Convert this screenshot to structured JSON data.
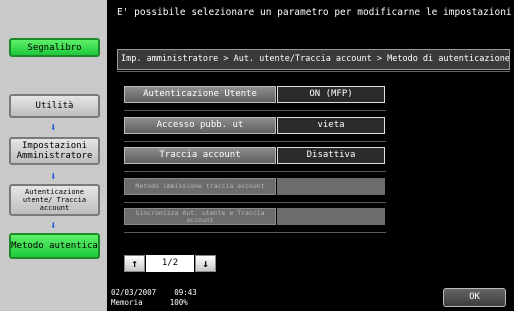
{
  "message": "E' possibile selezionare un parametro per modificarne le impostazioni.",
  "sidebar": {
    "bookmark": "Segnalibro",
    "items": [
      {
        "label": "Utilità"
      },
      {
        "label": "Impostazioni Amministratore"
      },
      {
        "label": "Autenticazione utente/ Traccia account"
      },
      {
        "label": "Metodo autentica"
      }
    ]
  },
  "breadcrumb": "Imp. amministratore > Aut. utente/Traccia account > Metodo di autenticazione",
  "settings": [
    {
      "label": "Autenticazione Utente",
      "value": "ON (MFP)"
    },
    {
      "label": "Accesso pubb. ut",
      "value": "vieta"
    },
    {
      "label": "Traccia account",
      "value": "Disattiva"
    },
    {
      "label": "Metodo immissione traccia account",
      "value": ""
    },
    {
      "label": "Sincronizza Aut. utente e Traccia account",
      "value": ""
    }
  ],
  "pager": {
    "current": "1/2",
    "up": "↑",
    "down": "↓"
  },
  "status": {
    "date": "02/03/2007",
    "time": "09:43",
    "memory_label": "Memoria",
    "memory_value": "100%"
  },
  "ok": "OK"
}
